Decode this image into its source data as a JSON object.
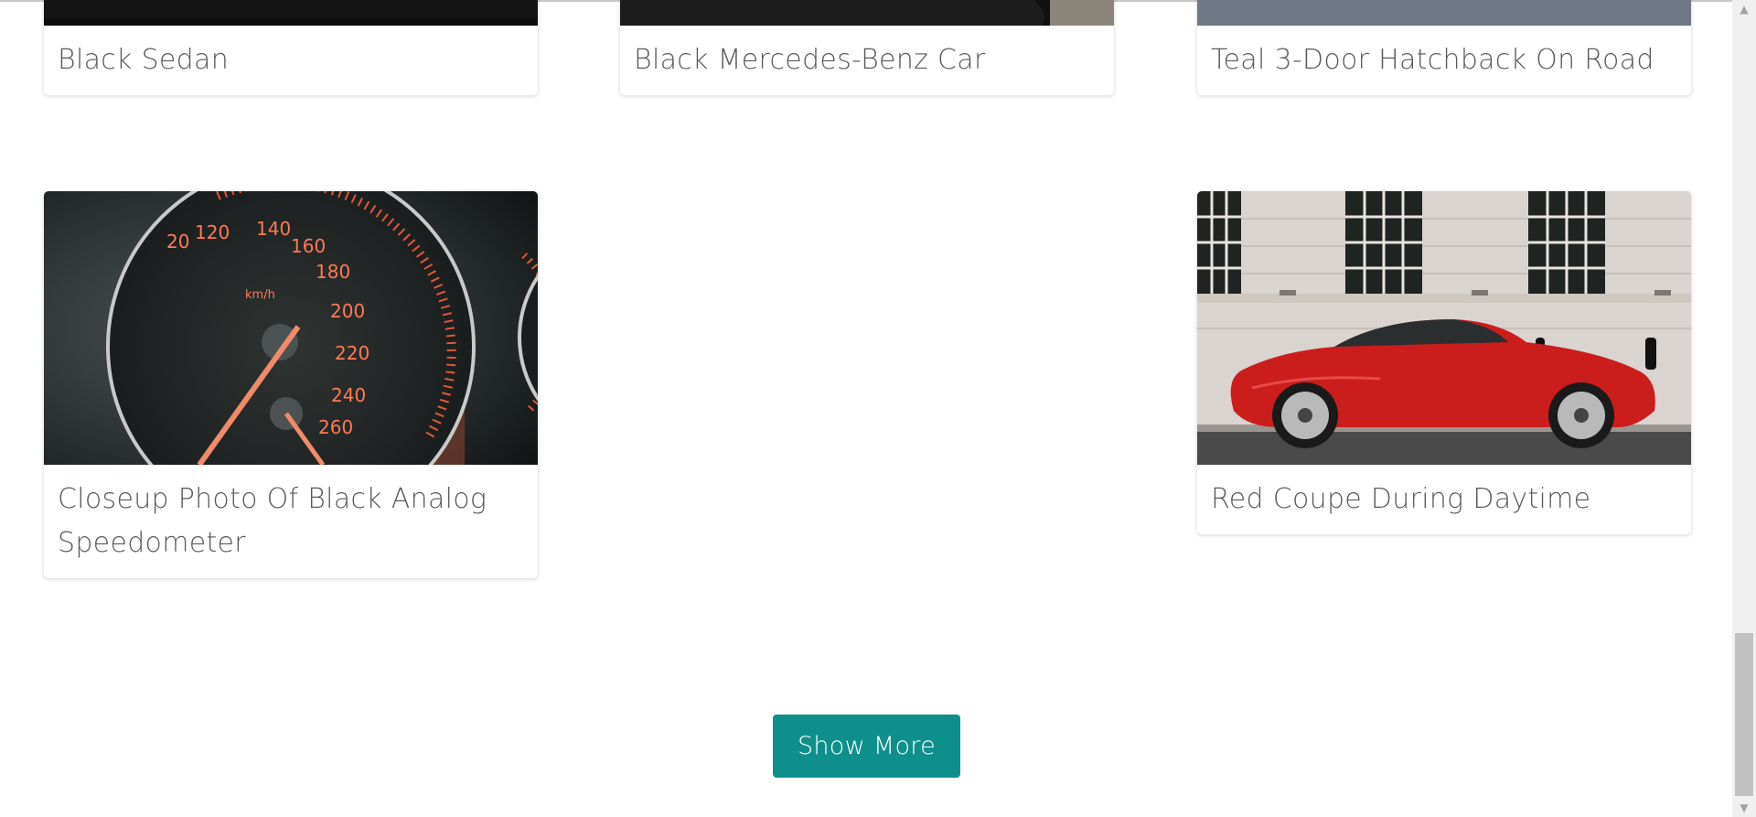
{
  "cards": [
    {
      "title": "Black Sedan"
    },
    {
      "title": "Black Mercedes-Benz Car"
    },
    {
      "title": "Teal 3-Door Hatchback On Road"
    },
    {
      "title": "Closeup Photo Of Black Analog Speedometer"
    },
    {
      "title": "Red Coupe During Daytime"
    }
  ],
  "speedometer": {
    "ticks": [
      "20",
      "120",
      "140",
      "160",
      "180",
      "200",
      "220",
      "240",
      "260"
    ],
    "unit": "km/h"
  },
  "show_more_label": "Show More",
  "colors": {
    "accent": "#0f8f8c",
    "title_text": "#5a5a5a",
    "scrollbar_track": "#f0f0f0",
    "scrollbar_thumb": "#c1c1c1"
  },
  "icons": {
    "scroll_up": "triangle-up-icon",
    "scroll_down": "triangle-down-icon"
  }
}
